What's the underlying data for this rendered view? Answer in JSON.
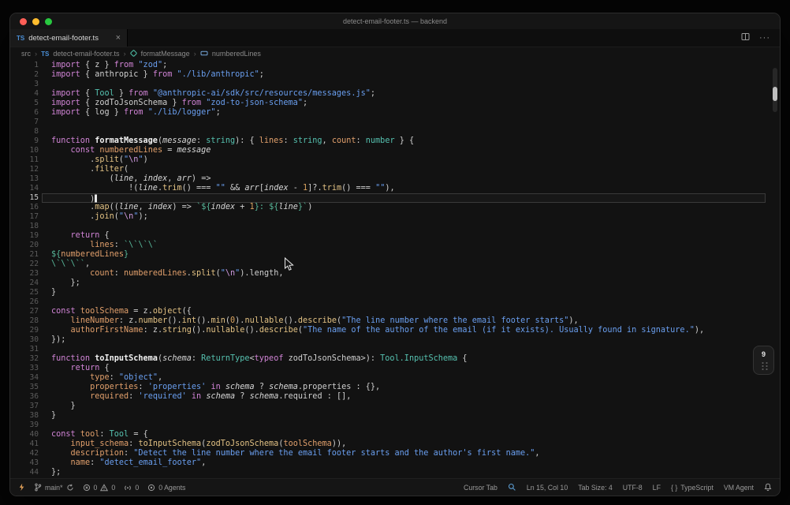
{
  "window": {
    "title": "detect-email-footer.ts — backend"
  },
  "tab": {
    "file_icon": "TS",
    "label": "detect-email-footer.ts",
    "close": "×"
  },
  "tabbar_actions": {
    "more": "···"
  },
  "breadcrumb": {
    "root": "src",
    "file_icon": "TS",
    "file": "detect-email-footer.ts",
    "method": "formatMessage",
    "variable": "numberedLines",
    "separator": "›"
  },
  "editor": {
    "cursor_line": 15,
    "lines": [
      {
        "n": 1,
        "t": [
          [
            "k",
            "import "
          ],
          [
            "p",
            "{ z } "
          ],
          [
            "k",
            "from "
          ],
          [
            "s",
            "\"zod\""
          ],
          [
            "p",
            ";"
          ]
        ]
      },
      {
        "n": 2,
        "t": [
          [
            "k",
            "import "
          ],
          [
            "p",
            "{ anthropic } "
          ],
          [
            "k",
            "from "
          ],
          [
            "s",
            "\"./lib/anthropic\""
          ],
          [
            "p",
            ";"
          ]
        ]
      },
      {
        "n": 3,
        "t": []
      },
      {
        "n": 4,
        "t": [
          [
            "k",
            "import "
          ],
          [
            "p",
            "{ "
          ],
          [
            "t",
            "Tool"
          ],
          [
            "p",
            " } "
          ],
          [
            "k",
            "from "
          ],
          [
            "s",
            "\"@anthropic-ai/sdk/src/resources/messages.js\""
          ],
          [
            "p",
            ";"
          ]
        ]
      },
      {
        "n": 5,
        "t": [
          [
            "k",
            "import "
          ],
          [
            "p",
            "{ zodToJsonSchema } "
          ],
          [
            "k",
            "from "
          ],
          [
            "s",
            "\"zod-to-json-schema\""
          ],
          [
            "p",
            ";"
          ]
        ]
      },
      {
        "n": 6,
        "t": [
          [
            "k",
            "import "
          ],
          [
            "p",
            "{ log } "
          ],
          [
            "k",
            "from "
          ],
          [
            "s",
            "\"./lib/logger\""
          ],
          [
            "p",
            ";"
          ]
        ]
      },
      {
        "n": 7,
        "t": []
      },
      {
        "n": 8,
        "t": []
      },
      {
        "n": 9,
        "t": [
          [
            "k",
            "function "
          ],
          [
            "f",
            "formatMessage"
          ],
          [
            "p",
            "("
          ],
          [
            "a",
            "message"
          ],
          [
            "p",
            ": "
          ],
          [
            "t",
            "string"
          ],
          [
            "p",
            "): { "
          ],
          [
            "v",
            "lines"
          ],
          [
            "p",
            ": "
          ],
          [
            "t",
            "string"
          ],
          [
            "p",
            ", "
          ],
          [
            "v",
            "count"
          ],
          [
            "p",
            ": "
          ],
          [
            "t",
            "number"
          ],
          [
            "p",
            " } {"
          ]
        ]
      },
      {
        "n": 10,
        "t": [
          [
            "p",
            "    "
          ],
          [
            "k",
            "const "
          ],
          [
            "v",
            "numberedLines"
          ],
          [
            "p",
            " = "
          ],
          [
            "a",
            "message"
          ]
        ]
      },
      {
        "n": 11,
        "t": [
          [
            "p",
            "        ."
          ],
          [
            "m",
            "split"
          ],
          [
            "p",
            "("
          ],
          [
            "s",
            "\""
          ],
          [
            "e",
            "\\n"
          ],
          [
            "s",
            "\""
          ],
          [
            "p",
            ")"
          ]
        ]
      },
      {
        "n": 12,
        "t": [
          [
            "p",
            "        ."
          ],
          [
            "m",
            "filter"
          ],
          [
            "p",
            "("
          ]
        ]
      },
      {
        "n": 13,
        "t": [
          [
            "p",
            "            ("
          ],
          [
            "a",
            "line"
          ],
          [
            "p",
            ", "
          ],
          [
            "a",
            "index"
          ],
          [
            "p",
            ", "
          ],
          [
            "a",
            "arr"
          ],
          [
            "p",
            ") =>"
          ]
        ]
      },
      {
        "n": 14,
        "t": [
          [
            "p",
            "                !("
          ],
          [
            "a",
            "line"
          ],
          [
            "p",
            "."
          ],
          [
            "m",
            "trim"
          ],
          [
            "p",
            "() === "
          ],
          [
            "s",
            "\"\""
          ],
          [
            "p",
            " && "
          ],
          [
            "a",
            "arr"
          ],
          [
            "p",
            "["
          ],
          [
            "a",
            "index"
          ],
          [
            "p",
            " - "
          ],
          [
            "n",
            "1"
          ],
          [
            "p",
            "]?."
          ],
          [
            "m",
            "trim"
          ],
          [
            "p",
            "() === "
          ],
          [
            "s",
            "\"\""
          ],
          [
            "p",
            "),"
          ]
        ]
      },
      {
        "n": 15,
        "t": [
          [
            "p",
            "        )"
          ]
        ]
      },
      {
        "n": 16,
        "t": [
          [
            "p",
            "        ."
          ],
          [
            "m",
            "map"
          ],
          [
            "p",
            "(("
          ],
          [
            "a",
            "line"
          ],
          [
            "p",
            ", "
          ],
          [
            "a",
            "index"
          ],
          [
            "p",
            ") => "
          ],
          [
            "g",
            "`${"
          ],
          [
            "a",
            "index"
          ],
          [
            "p",
            " + "
          ],
          [
            "n",
            "1"
          ],
          [
            "g",
            "}: ${"
          ],
          [
            "a",
            "line"
          ],
          [
            "g",
            "}`"
          ],
          [
            "p",
            ")"
          ]
        ]
      },
      {
        "n": 17,
        "t": [
          [
            "p",
            "        ."
          ],
          [
            "m",
            "join"
          ],
          [
            "p",
            "("
          ],
          [
            "s",
            "\""
          ],
          [
            "e",
            "\\n"
          ],
          [
            "s",
            "\""
          ],
          [
            "p",
            ");"
          ]
        ]
      },
      {
        "n": 18,
        "t": []
      },
      {
        "n": 19,
        "t": [
          [
            "p",
            "    "
          ],
          [
            "k",
            "return"
          ],
          [
            "p",
            " {"
          ]
        ]
      },
      {
        "n": 20,
        "t": [
          [
            "p",
            "        "
          ],
          [
            "v",
            "lines"
          ],
          [
            "p",
            ": "
          ],
          [
            "g",
            "`\\`\\`\\`"
          ]
        ]
      },
      {
        "n": 21,
        "t": [
          [
            "g",
            "${"
          ],
          [
            "v",
            "numberedLines"
          ],
          [
            "g",
            "}"
          ]
        ]
      },
      {
        "n": 22,
        "t": [
          [
            "g",
            "\\`\\`\\``"
          ],
          [
            "p",
            ","
          ]
        ]
      },
      {
        "n": 23,
        "t": [
          [
            "p",
            "        "
          ],
          [
            "v",
            "count"
          ],
          [
            "p",
            ": "
          ],
          [
            "v",
            "numberedLines"
          ],
          [
            "p",
            "."
          ],
          [
            "m",
            "split"
          ],
          [
            "p",
            "("
          ],
          [
            "s",
            "\""
          ],
          [
            "e",
            "\\n"
          ],
          [
            "s",
            "\""
          ],
          [
            "p",
            ").length,"
          ]
        ]
      },
      {
        "n": 24,
        "t": [
          [
            "p",
            "    };"
          ]
        ]
      },
      {
        "n": 25,
        "t": [
          [
            "p",
            "}"
          ]
        ]
      },
      {
        "n": 26,
        "t": []
      },
      {
        "n": 27,
        "t": [
          [
            "k",
            "const "
          ],
          [
            "v",
            "toolSchema"
          ],
          [
            "p",
            " = z."
          ],
          [
            "m",
            "object"
          ],
          [
            "p",
            "({"
          ]
        ]
      },
      {
        "n": 28,
        "t": [
          [
            "p",
            "    "
          ],
          [
            "v",
            "lineNumber"
          ],
          [
            "p",
            ": z."
          ],
          [
            "m",
            "number"
          ],
          [
            "p",
            "()."
          ],
          [
            "m",
            "int"
          ],
          [
            "p",
            "()."
          ],
          [
            "m",
            "min"
          ],
          [
            "p",
            "("
          ],
          [
            "n",
            "0"
          ],
          [
            "p",
            ")."
          ],
          [
            "m",
            "nullable"
          ],
          [
            "p",
            "()."
          ],
          [
            "m",
            "describe"
          ],
          [
            "p",
            "("
          ],
          [
            "s",
            "\"The line number where the email footer starts\""
          ],
          [
            "p",
            "),"
          ]
        ]
      },
      {
        "n": 29,
        "t": [
          [
            "p",
            "    "
          ],
          [
            "v",
            "authorFirstName"
          ],
          [
            "p",
            ": z."
          ],
          [
            "m",
            "string"
          ],
          [
            "p",
            "()."
          ],
          [
            "m",
            "nullable"
          ],
          [
            "p",
            "()."
          ],
          [
            "m",
            "describe"
          ],
          [
            "p",
            "("
          ],
          [
            "s",
            "\"The name of the author of the email (if it exists). Usually found in signature.\""
          ],
          [
            "p",
            "),"
          ]
        ]
      },
      {
        "n": 30,
        "t": [
          [
            "p",
            "});"
          ]
        ]
      },
      {
        "n": 31,
        "t": []
      },
      {
        "n": 32,
        "t": [
          [
            "k",
            "function "
          ],
          [
            "f",
            "toInputSchema"
          ],
          [
            "p",
            "("
          ],
          [
            "a",
            "schema"
          ],
          [
            "p",
            ": "
          ],
          [
            "t",
            "ReturnType"
          ],
          [
            "p",
            "<"
          ],
          [
            "k",
            "typeof"
          ],
          [
            "p",
            " zodToJsonSchema>): "
          ],
          [
            "t",
            "Tool.InputSchema"
          ],
          [
            "p",
            " {"
          ]
        ]
      },
      {
        "n": 33,
        "t": [
          [
            "p",
            "    "
          ],
          [
            "k",
            "return"
          ],
          [
            "p",
            " {"
          ]
        ]
      },
      {
        "n": 34,
        "t": [
          [
            "p",
            "        "
          ],
          [
            "v",
            "type"
          ],
          [
            "p",
            ": "
          ],
          [
            "s",
            "\"object\""
          ],
          [
            "p",
            ","
          ]
        ]
      },
      {
        "n": 35,
        "t": [
          [
            "p",
            "        "
          ],
          [
            "v",
            "properties"
          ],
          [
            "p",
            ": "
          ],
          [
            "s",
            "'properties'"
          ],
          [
            "p",
            " "
          ],
          [
            "k",
            "in"
          ],
          [
            "p",
            " "
          ],
          [
            "a",
            "schema"
          ],
          [
            "p",
            " ? "
          ],
          [
            "a",
            "schema"
          ],
          [
            "p",
            ".properties : {},"
          ]
        ]
      },
      {
        "n": 36,
        "t": [
          [
            "p",
            "        "
          ],
          [
            "v",
            "required"
          ],
          [
            "p",
            ": "
          ],
          [
            "s",
            "'required'"
          ],
          [
            "p",
            " "
          ],
          [
            "k",
            "in"
          ],
          [
            "p",
            " "
          ],
          [
            "a",
            "schema"
          ],
          [
            "p",
            " ? "
          ],
          [
            "a",
            "schema"
          ],
          [
            "p",
            ".required : [],"
          ]
        ]
      },
      {
        "n": 37,
        "t": [
          [
            "p",
            "    }"
          ]
        ]
      },
      {
        "n": 38,
        "t": [
          [
            "p",
            "}"
          ]
        ]
      },
      {
        "n": 39,
        "t": []
      },
      {
        "n": 40,
        "t": [
          [
            "k",
            "const "
          ],
          [
            "v",
            "tool"
          ],
          [
            "p",
            ": "
          ],
          [
            "t",
            "Tool"
          ],
          [
            "p",
            " = {"
          ]
        ]
      },
      {
        "n": 41,
        "t": [
          [
            "p",
            "    "
          ],
          [
            "v",
            "input_schema"
          ],
          [
            "p",
            ": "
          ],
          [
            "m",
            "toInputSchema"
          ],
          [
            "p",
            "("
          ],
          [
            "m",
            "zodToJsonSchema"
          ],
          [
            "p",
            "("
          ],
          [
            "v",
            "toolSchema"
          ],
          [
            "p",
            ")),"
          ]
        ]
      },
      {
        "n": 42,
        "t": [
          [
            "p",
            "    "
          ],
          [
            "v",
            "description"
          ],
          [
            "p",
            ": "
          ],
          [
            "s",
            "\"Detect the line number where the email footer starts and the author's first name.\""
          ],
          [
            "p",
            ","
          ]
        ]
      },
      {
        "n": 43,
        "t": [
          [
            "p",
            "    "
          ],
          [
            "v",
            "name"
          ],
          [
            "p",
            ": "
          ],
          [
            "s",
            "\"detect_email_footer\""
          ],
          [
            "p",
            ","
          ]
        ]
      },
      {
        "n": 44,
        "t": [
          [
            "p",
            "};"
          ]
        ]
      }
    ]
  },
  "widget": {
    "badge": "9"
  },
  "status": {
    "branch": "main*",
    "errors": "0",
    "warnings": "0",
    "indicator": "0",
    "agents": "0 Agents",
    "cursor_tab": "Cursor Tab",
    "position": "Ln 15, Col 10",
    "tab_size": "Tab Size: 4",
    "encoding": "UTF-8",
    "eol": "LF",
    "language_icon": "{ }",
    "language": "TypeScript",
    "vm": "VM Agent"
  },
  "colors": {
    "traffic_red": "#ff5f57",
    "traffic_yellow": "#febc2e",
    "traffic_green": "#28c840",
    "ts_blue": "#4a8fd6",
    "keyword": "#d184d6",
    "string": "#6a9ff0",
    "property": "#e2a06c",
    "method": "#e3c284",
    "type": "#56c2b0",
    "template": "#58b89a",
    "number": "#d8a25f",
    "editor_bg": "#121212"
  }
}
